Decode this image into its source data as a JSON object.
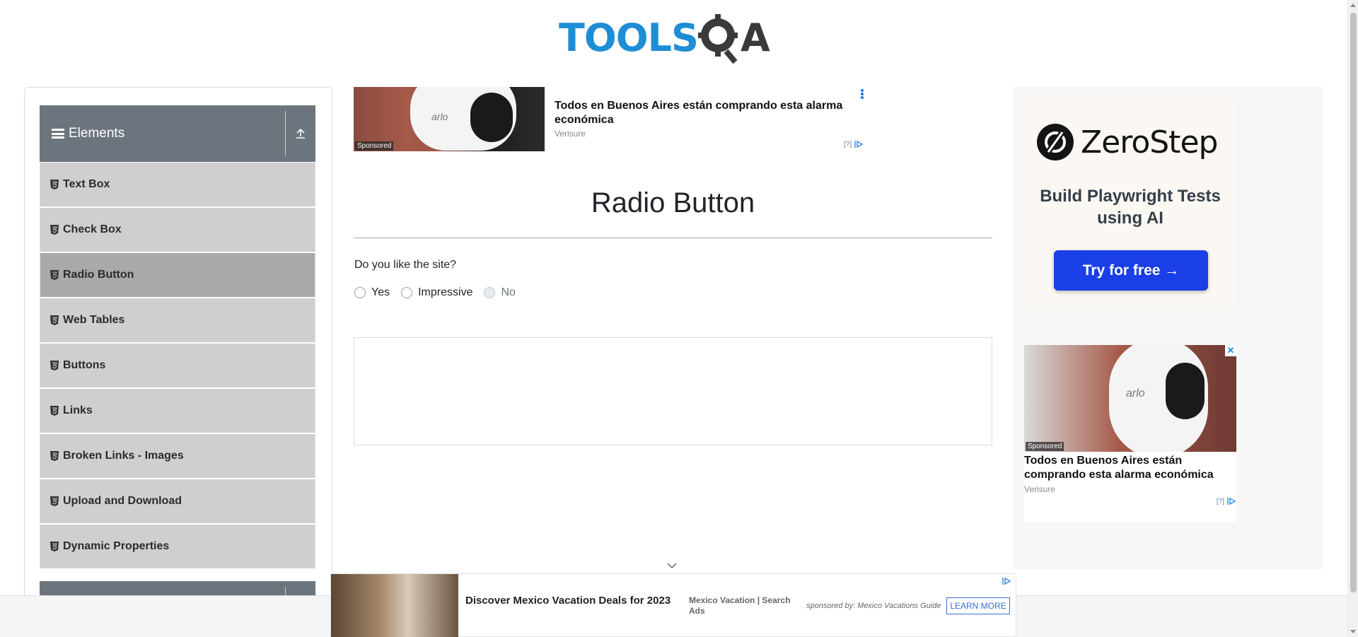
{
  "logo": {
    "part1": "TOOLS",
    "part2": "A"
  },
  "sidebar": {
    "group_title": "Elements",
    "items": [
      {
        "label": "Text Box",
        "active": false
      },
      {
        "label": "Check Box",
        "active": false
      },
      {
        "label": "Radio Button",
        "active": true
      },
      {
        "label": "Web Tables",
        "active": false
      },
      {
        "label": "Buttons",
        "active": false
      },
      {
        "label": "Links",
        "active": false
      },
      {
        "label": "Broken Links - Images",
        "active": false
      },
      {
        "label": "Upload and Download",
        "active": false
      },
      {
        "label": "Dynamic Properties",
        "active": false
      }
    ]
  },
  "top_ad": {
    "brand": "arlo",
    "tag": "Sponsored",
    "headline": "Todos en Buenos Aires están comprando esta alarma económica",
    "advertiser": "Verisure",
    "choice": "[?]"
  },
  "main": {
    "title": "Radio Button",
    "question": "Do you like the site?",
    "options": [
      {
        "label": "Yes",
        "disabled": false
      },
      {
        "label": "Impressive",
        "disabled": false
      },
      {
        "label": "No",
        "disabled": true
      }
    ]
  },
  "right_ad": {
    "zero_name": "ZeroStep",
    "zero_sub": "Build Playwright Tests using AI",
    "zero_btn": "Try for free →",
    "ad2_brand": "arlo",
    "ad2_tag": "Sponsored",
    "ad2_headline": "Todos en Buenos Aires están comprando esta alarma económica",
    "ad2_advertiser": "Verisure",
    "ad2_choice": "[?]",
    "ad2_close": "✕"
  },
  "bottom_ad": {
    "headline": "Discover Mexico Vacation Deals for 2023",
    "advertiser": "Mexico Vacation | Search Ads",
    "sponsor": "sponsored by: Mexico Vacations Guide",
    "cta": "LEARN MORE"
  },
  "colors": {
    "brand_blue": "#1f8dd6",
    "sidebar_header": "#6c757d",
    "menu_item": "#cfcfcf",
    "menu_active": "#a9a9a9",
    "cta_blue": "#1a3fe6"
  }
}
